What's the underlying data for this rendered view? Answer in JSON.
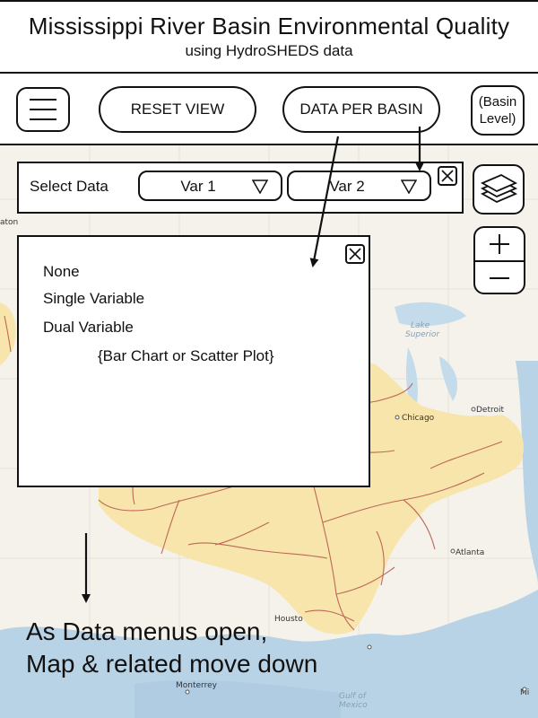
{
  "header": {
    "title": "Mississippi River Basin Environmental Quality",
    "subtitle": "using HydroSHEDS data"
  },
  "toolbar": {
    "menu_icon": "hamburger-menu-icon",
    "reset_label": "RESET VIEW",
    "data_label": "DATA PER BASIN",
    "basin_label": "(Basin\nLevel)"
  },
  "select": {
    "label": "Select Data",
    "var1": "Var 1",
    "var2": "Var 2"
  },
  "dropdown": {
    "options": [
      "None",
      "Single Variable",
      "Dual Variable"
    ],
    "note": "{Bar Chart or Scatter Plot}"
  },
  "map": {
    "labels": {
      "lake_superior": "Lake\nSuperior",
      "chicago": "Chicago",
      "detroit": "Detroit",
      "atlanta": "Atlanta",
      "houston": "Housto",
      "monterrey": "Monterrey",
      "gulf": "Gulf of\nMexico",
      "left_edge": "aton",
      "right_edge": "Mi"
    },
    "colors": {
      "land": "#f4f2ea",
      "water": "#b9d3e6",
      "basin": "#f8e5ac",
      "rivers": "#b85a4c",
      "lake": "#c4dbeb"
    }
  },
  "annotation": {
    "line1": "As Data menus open,",
    "line2": "Map & related move down"
  }
}
